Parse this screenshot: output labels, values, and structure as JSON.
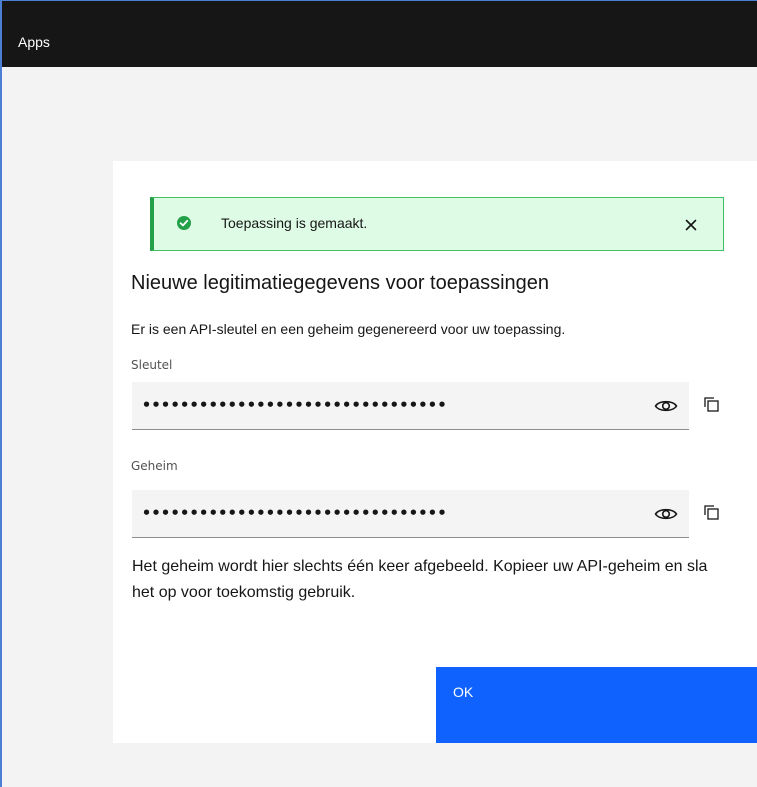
{
  "header": {
    "title": "Apps"
  },
  "notification": {
    "message": "Toepassing is gemaakt.",
    "status_color": "#24a148"
  },
  "modal": {
    "title": "Nieuwe legitimatiegegevens voor toepassingen",
    "description": "Er is een API-sleutel en een geheim gegenereerd voor uw toepassing.",
    "fields": [
      {
        "label": "Sleutel",
        "value": "••••••••••••••••••••••••••••••••"
      },
      {
        "label": "Geheim",
        "value": "••••••••••••••••••••••••••••••••"
      }
    ],
    "note": "Het geheim wordt hier slechts één keer afgebeeld. Kopieer uw API-geheim en sla het op voor toekomstig gebruik.",
    "ok_label": "OK"
  },
  "colors": {
    "header_bg": "#161616",
    "primary": "#0f62fe",
    "success_bg": "#defbe6"
  }
}
